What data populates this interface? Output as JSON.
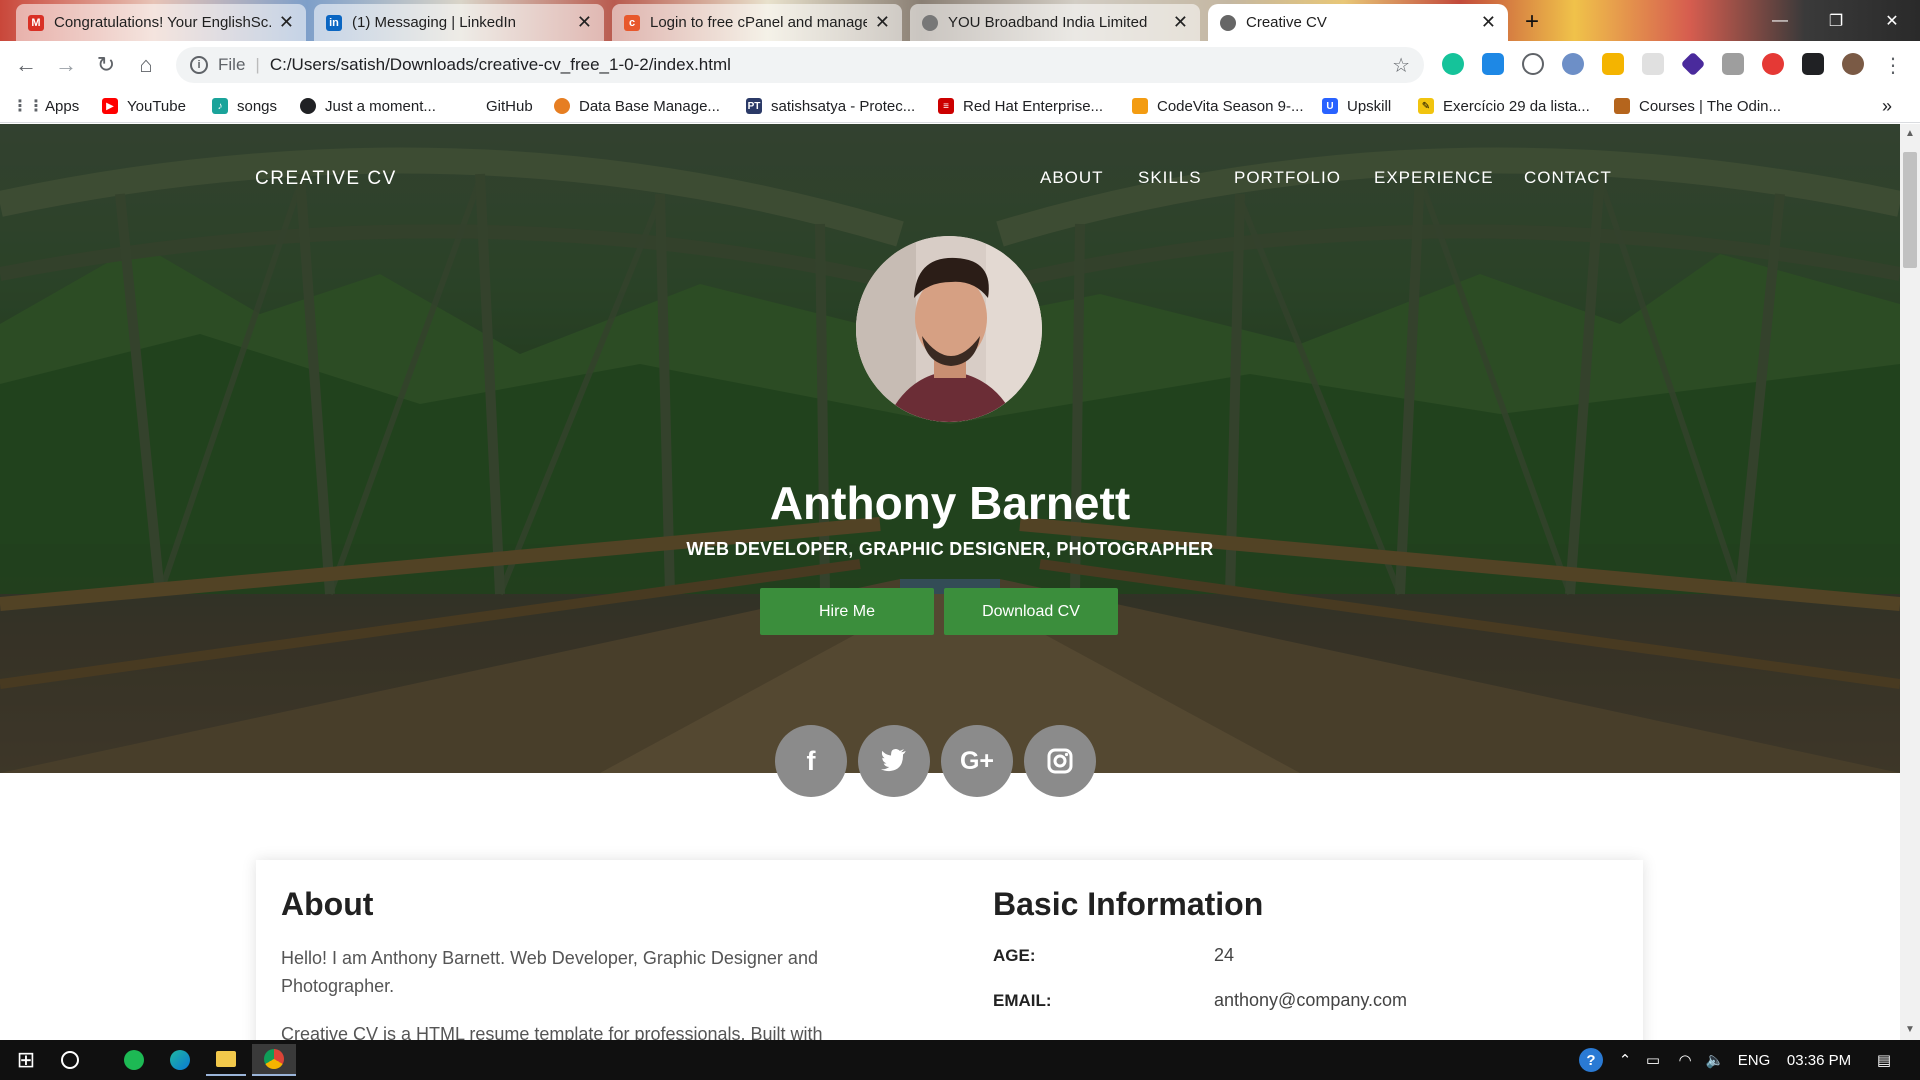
{
  "browser": {
    "tabs": [
      {
        "title": "Congratulations! Your EnglishSc...",
        "favicon_color": "#d93025",
        "favicon_letter": "M"
      },
      {
        "title": "(1) Messaging | LinkedIn",
        "favicon_color": "#0a66c2",
        "favicon_letter": "in"
      },
      {
        "title": "Login to free cPanel and manage",
        "favicon_color": "#e8582c",
        "favicon_letter": "c"
      },
      {
        "title": "YOU Broadband India Limited",
        "favicon_color": "#777777",
        "favicon_letter": ""
      },
      {
        "title": "Creative CV",
        "favicon_color": "#666666",
        "favicon_letter": ""
      }
    ],
    "url_scheme": "File",
    "url": "C:/Users/satish/Downloads/creative-cv_free_1-0-2/index.html",
    "bookmarks": [
      {
        "label": "Apps",
        "icon": "apps-grid-icon",
        "color": "#5f6368"
      },
      {
        "label": "YouTube",
        "icon": "youtube-icon",
        "color": "#ff0000"
      },
      {
        "label": "songs",
        "icon": "music-icon",
        "color": "#1aa39a"
      },
      {
        "label": "Just a moment...",
        "icon": "globe-icon",
        "color": "#202124"
      },
      {
        "label": "GitHub",
        "icon": "",
        "color": ""
      },
      {
        "label": "Data Base Manage...",
        "icon": "db-icon",
        "color": "#e67e22"
      },
      {
        "label": "satishsatya - Protec...",
        "icon": "pt-icon",
        "color": "#2b3a67"
      },
      {
        "label": "Red Hat Enterprise...",
        "icon": "redhat-icon",
        "color": "#cc0000"
      },
      {
        "label": "CodeVita Season 9-...",
        "icon": "codevita-icon",
        "color": "#f39c12"
      },
      {
        "label": "Upskill",
        "icon": "upskill-icon",
        "color": "#2962ff"
      },
      {
        "label": "Exercício 29 da lista...",
        "icon": "exercise-icon",
        "color": "#f1c40f"
      },
      {
        "label": "Courses | The Odin...",
        "icon": "odin-icon",
        "color": "#b5651d"
      }
    ]
  },
  "site": {
    "brand": "CREATIVE CV",
    "nav": [
      "ABOUT",
      "SKILLS",
      "PORTFOLIO",
      "EXPERIENCE",
      "CONTACT"
    ],
    "name": "Anthony Barnett",
    "role": "WEB DEVELOPER, GRAPHIC DESIGNER, PHOTOGRAPHER",
    "hire_label": "Hire Me",
    "download_label": "Download CV",
    "social": [
      "facebook-icon",
      "twitter-icon",
      "google-plus-icon",
      "instagram-icon"
    ],
    "about": {
      "heading": "About",
      "paragraph1_line1": "Hello! I am Anthony Barnett. Web Developer, Graphic Designer and",
      "paragraph1_line2": "Photographer.",
      "paragraph2": "Creative CV is a HTML resume template for professionals. Built with"
    },
    "basic_info": {
      "heading": "Basic Information",
      "rows": [
        {
          "label": "AGE:",
          "value": "24"
        },
        {
          "label": "EMAIL:",
          "value": "anthony@company.com"
        }
      ]
    }
  },
  "taskbar": {
    "lang": "ENG",
    "time": "03:36 PM"
  }
}
